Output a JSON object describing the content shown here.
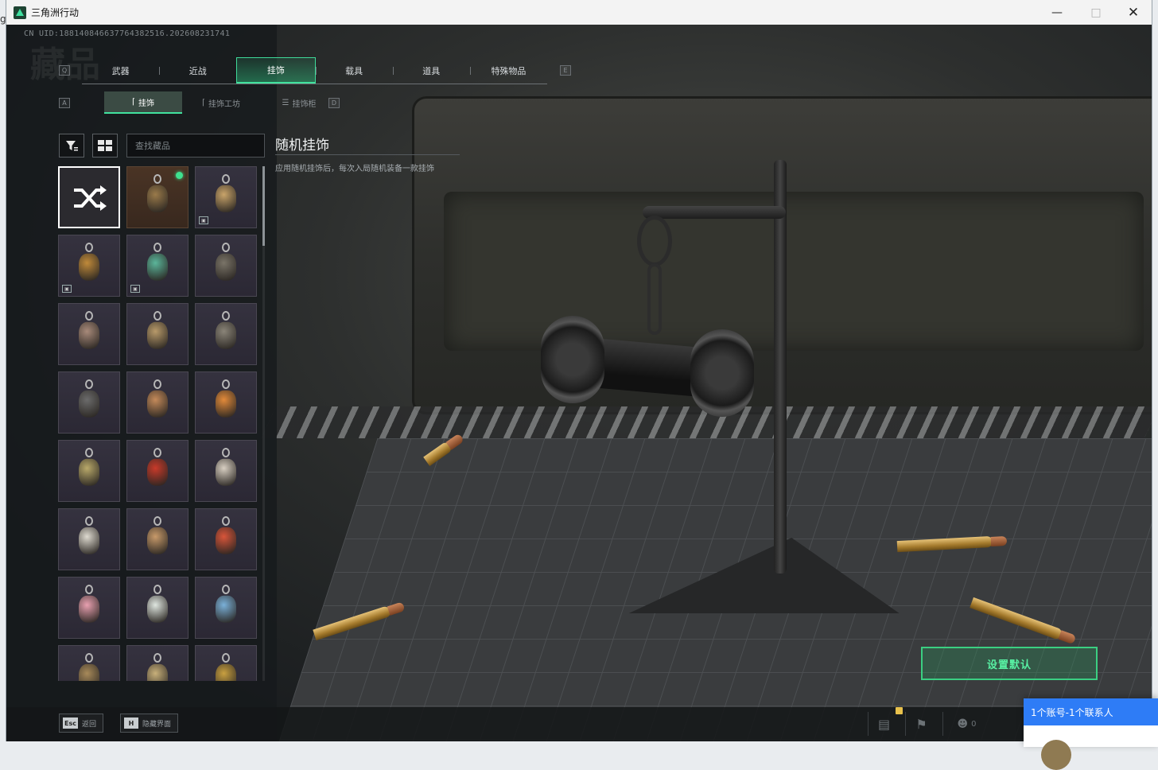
{
  "window": {
    "title": "三角洲行动",
    "minimize_icon": "minimize-icon",
    "maximize_icon": "maximize-icon",
    "close_icon": "close-icon"
  },
  "uid_text": "CN UID:1881408466377643825​16.202608231741",
  "watermark": "藏品",
  "tabs": {
    "left_key": "Q",
    "right_key": "E",
    "items": [
      {
        "label": "武器",
        "active": false
      },
      {
        "label": "近战",
        "active": false
      },
      {
        "label": "挂饰",
        "active": true
      },
      {
        "label": "载具",
        "active": false
      },
      {
        "label": "道具",
        "active": false
      },
      {
        "label": "特殊物品",
        "active": false
      }
    ]
  },
  "subtabs": {
    "left_key": "A",
    "right_key": "D",
    "items": [
      {
        "label": "挂饰",
        "icon": "charm-icon",
        "active": true
      },
      {
        "label": "挂饰工坊",
        "icon": "charm-icon",
        "active": false
      },
      {
        "label": "挂饰柜",
        "icon": "cabinet-icon",
        "active": false
      }
    ]
  },
  "filter": {
    "filter_icon": "filter-icon",
    "grid_view_icon": "grid-view-icon",
    "search_placeholder": "查找藏品"
  },
  "detail": {
    "title": "随机挂饰",
    "description": "应用随机挂饰后，每次入局随机装备一款挂饰"
  },
  "items": [
    {
      "name": "random",
      "icon": "shuffle-icon",
      "selected": true,
      "color": "#ffffff"
    },
    {
      "name": "gold-charm",
      "equipped": true,
      "color": "#9a7a4a",
      "bg": "gold"
    },
    {
      "name": "lantern-charm",
      "color": "#c9a46a",
      "tagged": true
    },
    {
      "name": "box-charm",
      "color": "#c08a3a",
      "tagged": true
    },
    {
      "name": "gem-charm",
      "color": "#5bb59a",
      "tagged": true
    },
    {
      "name": "number-charm",
      "color": "#7a7468"
    },
    {
      "name": "figure-charm",
      "color": "#a88a7a"
    },
    {
      "name": "moon-charm",
      "color": "#b89a6a"
    },
    {
      "name": "tool-charm",
      "color": "#8a8478"
    },
    {
      "name": "dumbbell-charm",
      "color": "#6b6b6b"
    },
    {
      "name": "frame-charm",
      "color": "#c48a5a"
    },
    {
      "name": "fish-charm",
      "color": "#e28a3a"
    },
    {
      "name": "burger-charm",
      "color": "#b9a96a"
    },
    {
      "name": "dragon-charm",
      "color": "#c83a2a"
    },
    {
      "name": "rabbit-charm",
      "color": "#d8cfc2"
    },
    {
      "name": "plate-charm",
      "color": "#dedad0"
    },
    {
      "name": "cookie-charm",
      "color": "#c89a6a"
    },
    {
      "name": "clock-charm",
      "color": "#d8553a"
    },
    {
      "name": "cupcake-charm",
      "color": "#e8a0b0"
    },
    {
      "name": "tree-charm",
      "color": "#dfe6e0"
    },
    {
      "name": "butterfly-charm",
      "color": "#7ab0d8"
    },
    {
      "name": "key-charm",
      "color": "#a88a5a"
    },
    {
      "name": "bell-charm",
      "color": "#c8b07a"
    },
    {
      "name": "ring-charm",
      "color": "#c9a040"
    }
  ],
  "set_default_label": "设置默认",
  "bottom": {
    "back_key": "Esc",
    "back_label": "返回",
    "hide_key": "H",
    "hide_label": "隐藏界面",
    "friends_count": "0"
  },
  "popup": {
    "text": "1个账号-1个联系人"
  },
  "accent": "#41e29e"
}
